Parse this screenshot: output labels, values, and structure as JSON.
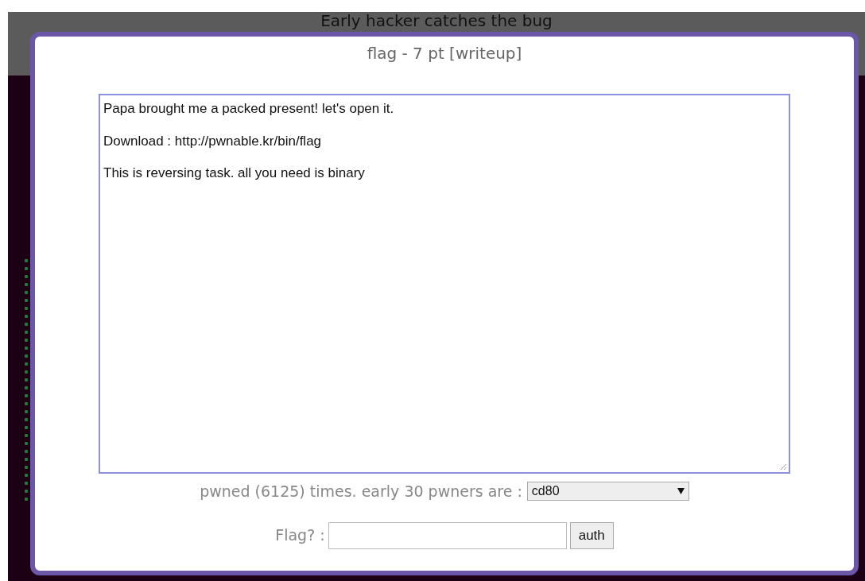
{
  "page": {
    "heading": "Early hacker catches the bug"
  },
  "modal": {
    "title": "flag - 7 pt [writeup]",
    "description": [
      "Papa brought me a packed present! let's open it.",
      "Download : http://pwnable.kr/bin/flag",
      "This is reversing task. all you need is binary"
    ],
    "pwned_label": "pwned (6125) times. early 30 pwners are :",
    "pwners_select": {
      "value": "cd80"
    },
    "flag_label": "Flag? :",
    "auth_button": "auth"
  }
}
